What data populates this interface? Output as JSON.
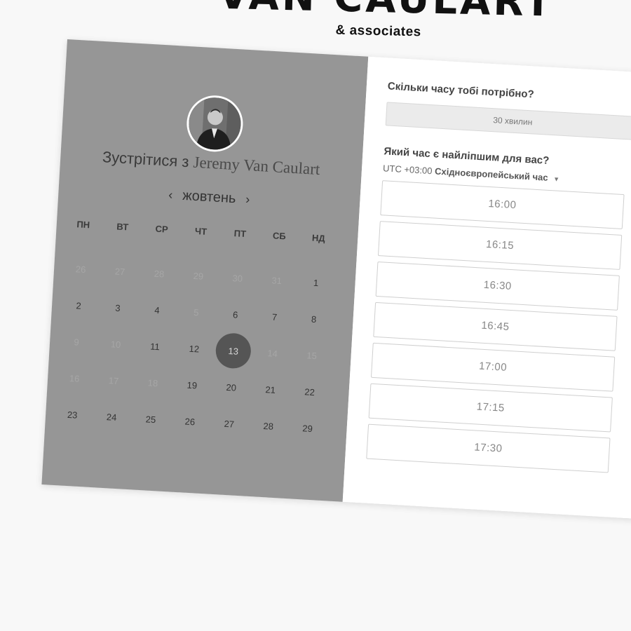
{
  "brand": {
    "name": "VAN CAULART",
    "sub": "& associates"
  },
  "meeting": {
    "title_prefix": "Зустрітися з",
    "host": "Jeremy Van Caulart"
  },
  "calendar": {
    "month": "жовтень",
    "prev": "‹",
    "next": "›",
    "weekdays": [
      "ПН",
      "ВТ",
      "СР",
      "ЧТ",
      "ПТ",
      "СБ",
      "НД"
    ],
    "days": [
      {
        "d": "26",
        "muted": true
      },
      {
        "d": "27",
        "muted": true
      },
      {
        "d": "28",
        "muted": true
      },
      {
        "d": "29",
        "muted": true
      },
      {
        "d": "30",
        "muted": true
      },
      {
        "d": "31",
        "muted": true
      },
      {
        "d": "1"
      },
      {
        "d": "2"
      },
      {
        "d": "3"
      },
      {
        "d": "4"
      },
      {
        "d": "5",
        "muted": true
      },
      {
        "d": "6"
      },
      {
        "d": "7"
      },
      {
        "d": "8"
      },
      {
        "d": "9",
        "muted": true
      },
      {
        "d": "10",
        "muted": true
      },
      {
        "d": "11"
      },
      {
        "d": "12"
      },
      {
        "d": "13",
        "selected": true
      },
      {
        "d": "14",
        "muted": true
      },
      {
        "d": "15",
        "muted": true
      },
      {
        "d": "16",
        "muted": true
      },
      {
        "d": "17",
        "muted": true
      },
      {
        "d": "18",
        "muted": true
      },
      {
        "d": "19"
      },
      {
        "d": "20"
      },
      {
        "d": "21"
      },
      {
        "d": "22"
      },
      {
        "d": "23"
      },
      {
        "d": "24"
      },
      {
        "d": "25"
      },
      {
        "d": "26"
      },
      {
        "d": "27"
      },
      {
        "d": "28"
      },
      {
        "d": "29"
      }
    ]
  },
  "booking": {
    "duration_question": "Скільки часу тобі потрібно?",
    "duration_value": "30 хвилин",
    "time_question": "Який час є найліпшим для вас?",
    "timezone_offset": "UTC +03:00",
    "timezone_name": "Східноєвропейський час",
    "slots": [
      "16:00",
      "16:15",
      "16:30",
      "16:45",
      "17:00",
      "17:15",
      "17:30"
    ]
  },
  "colors": {
    "left_panel": "#969696",
    "selected_day": "#555555",
    "page_bg": "#f8f8f8"
  }
}
